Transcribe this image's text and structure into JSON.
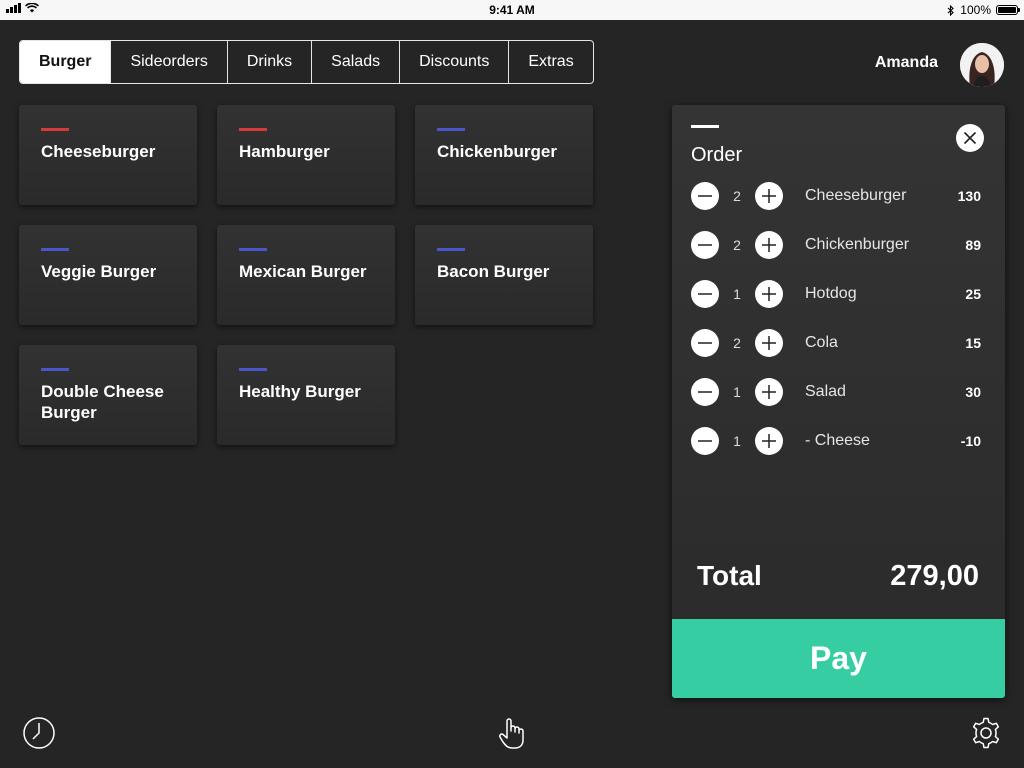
{
  "status_bar": {
    "time": "9:41 AM",
    "battery": "100%",
    "icons": [
      "signal-icon",
      "wifi-icon",
      "bluetooth-icon",
      "battery-icon"
    ]
  },
  "tabs": [
    {
      "label": "Burger",
      "active": true
    },
    {
      "label": "Sideorders",
      "active": false
    },
    {
      "label": "Drinks",
      "active": false
    },
    {
      "label": "Salads",
      "active": false
    },
    {
      "label": "Discounts",
      "active": false
    },
    {
      "label": "Extras",
      "active": false
    }
  ],
  "user": {
    "name": "Amanda"
  },
  "products": [
    {
      "name": "Cheeseburger",
      "color": "#d63a3a"
    },
    {
      "name": "Hamburger",
      "color": "#d63a3a"
    },
    {
      "name": "Chickenburger",
      "color": "#4a56c8"
    },
    {
      "name": "Veggie Burger",
      "color": "#4a56c8"
    },
    {
      "name": "Mexican Burger",
      "color": "#4a56c8"
    },
    {
      "name": "Bacon Burger",
      "color": "#4a56c8"
    },
    {
      "name": "Double Cheese Burger",
      "color": "#4a56c8"
    },
    {
      "name": "Healthy Burger",
      "color": "#4a56c8"
    }
  ],
  "order": {
    "title": "Order",
    "items": [
      {
        "qty": "2",
        "name": "Cheeseburger",
        "price": "130"
      },
      {
        "qty": "2",
        "name": "Chickenburger",
        "price": "89"
      },
      {
        "qty": "1",
        "name": "Hotdog",
        "price": "25"
      },
      {
        "qty": "2",
        "name": "Cola",
        "price": "15"
      },
      {
        "qty": "1",
        "name": "Salad",
        "price": "30"
      },
      {
        "qty": "1",
        "name": "- Cheese",
        "price": "-10"
      }
    ],
    "total_label": "Total",
    "total_value": "279,00",
    "pay_label": "Pay"
  },
  "colors": {
    "background": "#252525",
    "pay_button": "#35cda1",
    "red_accent": "#d63a3a",
    "blue_accent": "#4a56c8"
  },
  "bottom_bar": {
    "icons": [
      "clock-icon",
      "hand-pointer-icon",
      "settings-gear-icon"
    ]
  }
}
